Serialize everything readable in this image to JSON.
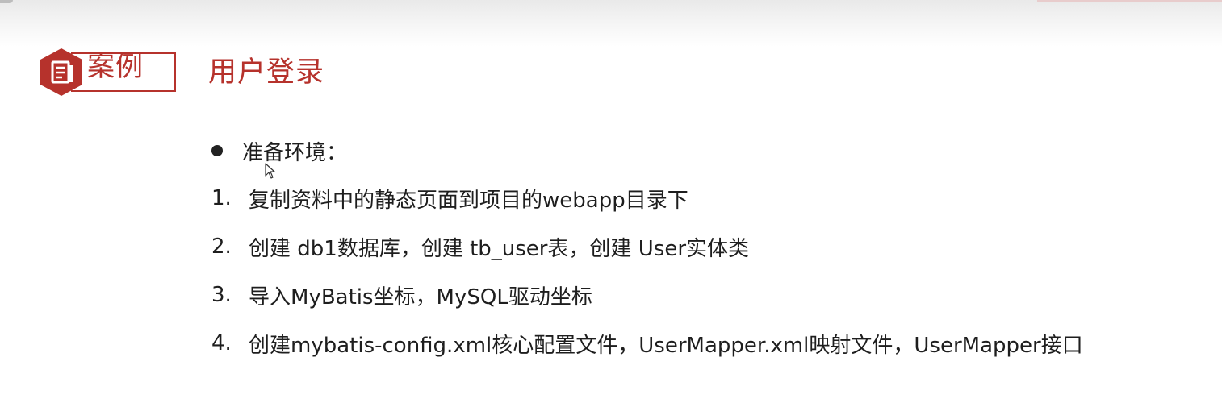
{
  "header": {
    "badge_label": "案例",
    "badge_icon": "document-icon",
    "title": "用户登录"
  },
  "content": {
    "bullet": "准备环境：",
    "steps": [
      {
        "num": "1.",
        "text": "复制资料中的静态页面到项目的webapp目录下"
      },
      {
        "num": "2.",
        "text": "创建 db1数据库，创建 tb_user表，创建 User实体类"
      },
      {
        "num": "3.",
        "text": "导入MyBatis坐标，MySQL驱动坐标"
      },
      {
        "num": "4.",
        "text": "创建mybatis-config.xml核心配置文件，UserMapper.xml映射文件，UserMapper接口"
      }
    ]
  },
  "colors": {
    "accent": "#b6322c",
    "text": "#1e1e1e"
  }
}
